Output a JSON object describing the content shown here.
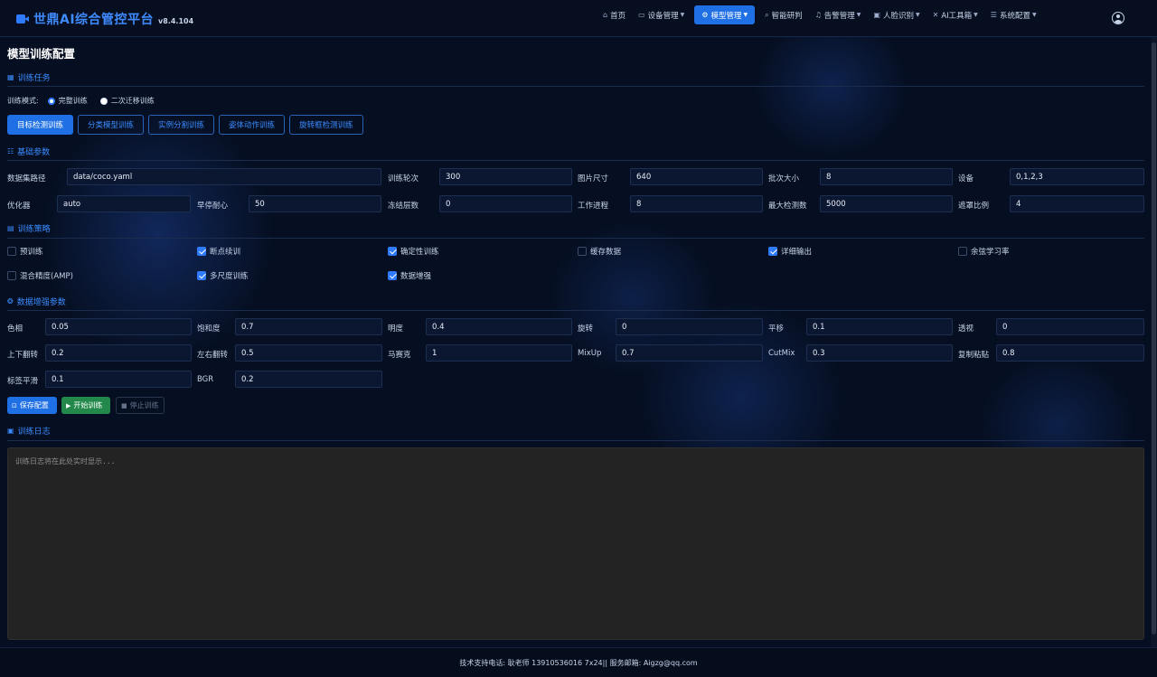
{
  "app": {
    "title": "世鼎AI综合管控平台",
    "version": "v8.4.104"
  },
  "nav": {
    "items": [
      {
        "label": "首页",
        "icon": "home-icon"
      },
      {
        "label": "设备管理",
        "icon": "camera-icon"
      },
      {
        "label": "模型管理",
        "icon": "gear-icon"
      },
      {
        "label": "智能研判",
        "icon": "search-icon"
      },
      {
        "label": "告警管理",
        "icon": "bell-icon"
      },
      {
        "label": "人脸识别",
        "icon": "id-card-icon"
      },
      {
        "label": "AI工具箱",
        "icon": "tools-icon"
      },
      {
        "label": "系统配置",
        "icon": "list-icon"
      }
    ]
  },
  "page": {
    "title": "模型训练配置"
  },
  "task": {
    "section_title": "训练任务",
    "mode_label": "训练模式:",
    "modes": [
      "完整训练",
      "二次迁移训练"
    ],
    "tabs": [
      "目标检测训练",
      "分类模型训练",
      "实例分割训练",
      "姿体动作训练",
      "旋转框检测训练"
    ]
  },
  "basic": {
    "section_title": "基础参数",
    "params": [
      {
        "label": "数据集路径",
        "value": "data/coco.yaml"
      },
      {
        "label": "训练轮次",
        "value": "300"
      },
      {
        "label": "图片尺寸",
        "value": "640"
      },
      {
        "label": "批次大小",
        "value": "8"
      },
      {
        "label": "设备",
        "value": "0,1,2,3"
      },
      {
        "label": "优化器",
        "value": "auto"
      },
      {
        "label": "早停耐心",
        "value": "50"
      },
      {
        "label": "冻结层数",
        "value": "0"
      },
      {
        "label": "工作进程",
        "value": "8"
      },
      {
        "label": "最大检测数",
        "value": "5000"
      },
      {
        "label": "遮罩比例",
        "value": "4"
      }
    ]
  },
  "strategy": {
    "section_title": "训练策略",
    "options": [
      {
        "label": "预训练",
        "checked": false
      },
      {
        "label": "断点续训",
        "checked": true
      },
      {
        "label": "确定性训练",
        "checked": true
      },
      {
        "label": "缓存数据",
        "checked": false
      },
      {
        "label": "详细输出",
        "checked": true
      },
      {
        "label": "余弦学习率",
        "checked": false
      },
      {
        "label": "混合精度(AMP)",
        "checked": false
      },
      {
        "label": "多尺度训练",
        "checked": true
      },
      {
        "label": "数据增强",
        "checked": true
      }
    ]
  },
  "augment": {
    "section_title": "数据增强参数",
    "params": [
      {
        "label": "色相",
        "value": "0.05"
      },
      {
        "label": "饱和度",
        "value": "0.7"
      },
      {
        "label": "明度",
        "value": "0.4"
      },
      {
        "label": "旋转",
        "value": "0"
      },
      {
        "label": "平移",
        "value": "0.1"
      },
      {
        "label": "透视",
        "value": "0"
      },
      {
        "label": "上下翻转",
        "value": "0.2"
      },
      {
        "label": "左右翻转",
        "value": "0.5"
      },
      {
        "label": "马赛克",
        "value": "1"
      },
      {
        "label": "MixUp",
        "value": "0.7"
      },
      {
        "label": "CutMix",
        "value": "0.3"
      },
      {
        "label": "复制粘贴",
        "value": "0.8"
      },
      {
        "label": "标签平滑",
        "value": "0.1"
      },
      {
        "label": "BGR",
        "value": "0.2"
      }
    ]
  },
  "actions": {
    "save": "保存配置",
    "start": "开始训练",
    "stop": "停止训练"
  },
  "log": {
    "section_title": "训练日志",
    "placeholder": "训练日志将在此处实时显示..."
  },
  "footer": {
    "text": "技术支持电话: 耿老师 13910536016 7x24|| 服务邮箱: Aigzg@qq.com"
  },
  "colors": {
    "accent": "#1f6fe5",
    "start": "#23894a",
    "bg": "#060f22"
  }
}
